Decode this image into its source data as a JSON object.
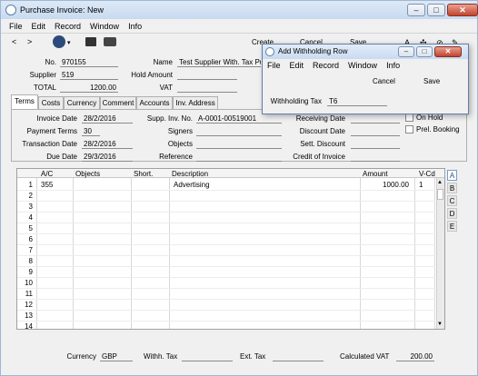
{
  "window": {
    "title": "Purchase Invoice: New"
  },
  "menu": [
    "File",
    "Edit",
    "Record",
    "Window",
    "Info"
  ],
  "toolbar": {
    "create_label": "Create",
    "cancel_label": "Cancel",
    "save_label": "Save"
  },
  "header": {
    "no_label": "No.",
    "no_value": "970155",
    "supplier_label": "Supplier",
    "supplier_value": "519",
    "total_label": "TOTAL",
    "total_value": "1200.00",
    "name_label": "Name",
    "name_value": "Test Supplier With. Tax Pur",
    "hold_amount_label": "Hold Amount",
    "hold_amount_value": "",
    "vat_label": "VAT",
    "vat_value": ""
  },
  "tabs": [
    "Terms",
    "Costs",
    "Currency",
    "Comment",
    "Accounts",
    "Inv. Address"
  ],
  "terms": {
    "invoice_date_label": "Invoice Date",
    "invoice_date": "28/2/2016",
    "payment_terms_label": "Payment Terms",
    "payment_terms": "30",
    "transaction_date_label": "Transaction Date",
    "transaction_date": "28/2/2016",
    "due_date_label": "Due Date",
    "due_date": "29/3/2016",
    "supp_inv_label": "Supp. Inv. No.",
    "supp_inv": "A-0001-00519001",
    "signers_label": "Signers",
    "signers": "",
    "objects_label": "Objects",
    "objects": "",
    "reference_label": "Reference",
    "reference": "",
    "receiving_date_label": "Receiving Date",
    "receiving_date": "",
    "discount_date_label": "Discount Date",
    "discount_date": "",
    "sett_discount_label": "Sett. Discount",
    "sett_discount": "",
    "credit_of_invoice_label": "Credit of Invoice",
    "credit_of_invoice": "",
    "on_hold_label": "On Hold",
    "prel_booking_label": "Prel. Booking"
  },
  "grid": {
    "columns": [
      "A/C",
      "Objects",
      "Short.",
      "Description",
      "Amount",
      "V-Cd"
    ],
    "rows": [
      {
        "n": "1",
        "ac": "355",
        "objects": "",
        "short": "",
        "description": "Advertising",
        "amount": "1000.00",
        "vcd": "1"
      },
      {
        "n": "2"
      },
      {
        "n": "3"
      },
      {
        "n": "4"
      },
      {
        "n": "5"
      },
      {
        "n": "6"
      },
      {
        "n": "7"
      },
      {
        "n": "8"
      },
      {
        "n": "9"
      },
      {
        "n": "10"
      },
      {
        "n": "11"
      },
      {
        "n": "12"
      },
      {
        "n": "13"
      },
      {
        "n": "14"
      }
    ],
    "side_tabs": [
      "A",
      "B",
      "C",
      "D",
      "E"
    ]
  },
  "footer": {
    "currency_label": "Currency",
    "currency_value": "GBP",
    "withh_tax_label": "Withh. Tax",
    "withh_tax_value": "",
    "ext_tax_label": "Ext. Tax",
    "ext_tax_value": "",
    "calc_vat_label": "Calculated VAT",
    "calc_vat_value": "200.00"
  },
  "dialog": {
    "title": "Add Withholding Row",
    "menu": [
      "File",
      "Edit",
      "Record",
      "Window",
      "Info"
    ],
    "cancel_label": "Cancel",
    "save_label": "Save",
    "withholding_tax_label": "Withholding Tax",
    "withholding_tax_value": "T6"
  }
}
